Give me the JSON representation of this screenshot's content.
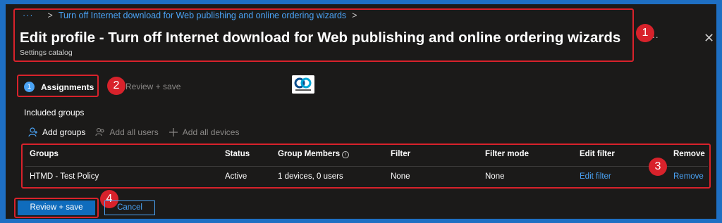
{
  "breadcrumb": {
    "dots": "···",
    "item": "Turn off Internet download for Web publishing and online ordering wizards",
    "sep": ">"
  },
  "header": {
    "title": "Edit profile - Turn off Internet download for Web publishing and online ordering wizards",
    "subtitle": "Settings catalog",
    "more": "···",
    "close": "✕"
  },
  "steps": [
    {
      "number": "1",
      "label": "Assignments",
      "active": true
    },
    {
      "number": "2",
      "label": "Review + save",
      "active": false
    }
  ],
  "logo": {
    "text": "HTMD Community"
  },
  "section": {
    "included_groups": "Included groups"
  },
  "toolbar": {
    "add_groups": "Add groups",
    "add_all_users": "Add all users",
    "add_all_devices": "Add all devices"
  },
  "table": {
    "headers": {
      "groups": "Groups",
      "status": "Status",
      "group_members": "Group Members",
      "filter": "Filter",
      "filter_mode": "Filter mode",
      "edit_filter": "Edit filter",
      "remove": "Remove"
    },
    "rows": [
      {
        "groups": "HTMD - Test Policy",
        "status": "Active",
        "group_members": "1 devices, 0 users",
        "filter": "None",
        "filter_mode": "None",
        "edit_filter": "Edit filter",
        "remove": "Remove"
      }
    ]
  },
  "footer": {
    "review_save": "Review + save",
    "cancel": "Cancel"
  },
  "annotations": [
    "1",
    "2",
    "3",
    "4"
  ],
  "colors": {
    "frame": "#1e6fc3",
    "background": "#1b1a19",
    "link": "#4aa3f5",
    "primary_button": "#0f6cbd",
    "annotation": "#d8222b"
  }
}
